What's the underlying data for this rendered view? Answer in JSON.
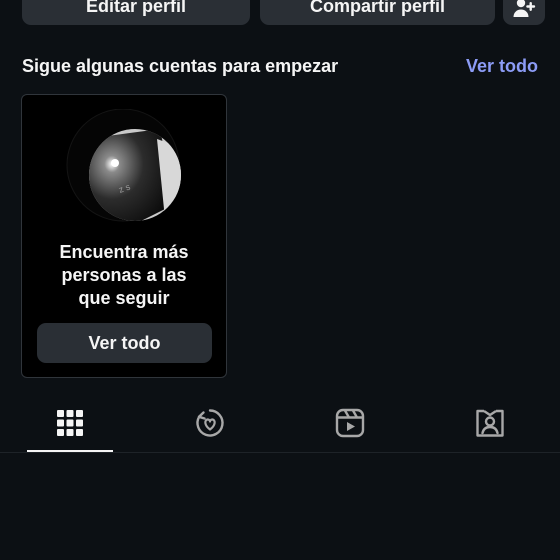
{
  "profile_actions": {
    "edit_label": "Editar perfil",
    "share_label": "Compartir perfil",
    "add_user_icon": "person-add-icon"
  },
  "suggestions": {
    "title": "Sigue algunas cuentas para empezar",
    "see_all_label": "Ver todo",
    "link_color": "#8c9cf6",
    "card": {
      "image_icon": "discover-people-image",
      "text": "Encuentra más personas a las que seguir",
      "button_label": "Ver todo"
    }
  },
  "tabs": [
    {
      "name": "grid",
      "icon": "grid-icon",
      "active": true
    },
    {
      "name": "reposts",
      "icon": "repost-heart-icon",
      "active": false
    },
    {
      "name": "reels",
      "icon": "reels-icon",
      "active": false
    },
    {
      "name": "tagged",
      "icon": "tagged-person-icon",
      "active": false
    }
  ],
  "colors": {
    "background": "#0c1014",
    "button": "#2a2f35",
    "card_background": "#000000",
    "text": "#f5f5f5"
  }
}
